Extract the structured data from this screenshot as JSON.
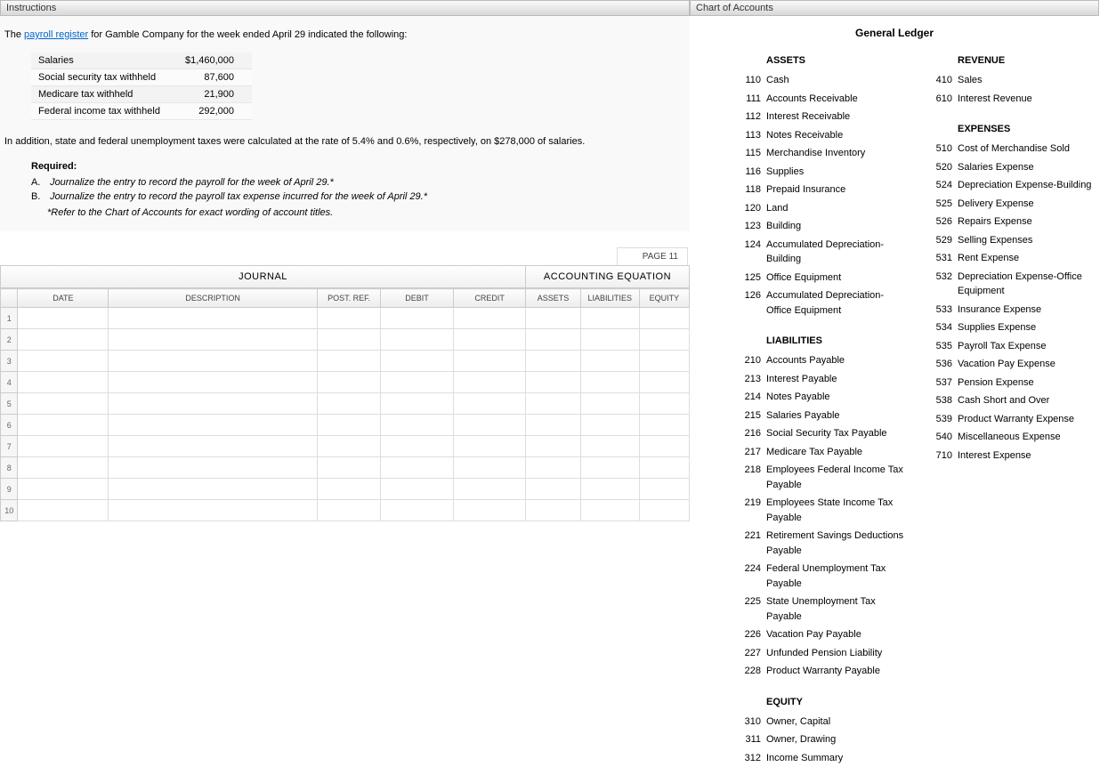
{
  "left": {
    "header": "Instructions",
    "intro_pre": "The ",
    "intro_link": "payroll register",
    "intro_post": " for Gamble Company for the week ended April 29 indicated the following:",
    "rows": [
      {
        "label": "Salaries",
        "value": "$1,460,000"
      },
      {
        "label": "Social security tax withheld",
        "value": "87,600"
      },
      {
        "label": "Medicare tax withheld",
        "value": "21,900"
      },
      {
        "label": "Federal income tax withheld",
        "value": "292,000"
      }
    ],
    "addl": "In addition, state and federal unemployment taxes were calculated at the rate of 5.4% and 0.6%, respectively, on $278,000 of salaries.",
    "required_h": "Required:",
    "req_a_lbl": "A.",
    "req_a": "Journalize the entry to record the payroll for the week of April 29.*",
    "req_b_lbl": "B.",
    "req_b": "Journalize the entry to record the payroll tax expense incurred for the week of April 29.*",
    "note": "*Refer to the Chart of Accounts for exact wording of account titles."
  },
  "journal": {
    "page": "PAGE 11",
    "h_journal": "JOURNAL",
    "h_acct": "ACCOUNTING EQUATION",
    "cols": {
      "date": "DATE",
      "desc": "DESCRIPTION",
      "post": "POST. REF.",
      "debit": "DEBIT",
      "credit": "CREDIT",
      "assets": "ASSETS",
      "liab": "LIABILITIES",
      "eq": "EQUITY"
    },
    "row_count": 10
  },
  "right": {
    "header": "Chart of Accounts",
    "title": "General Ledger",
    "sections": {
      "assets": {
        "h": "ASSETS",
        "items": [
          {
            "n": "110",
            "name": "Cash"
          },
          {
            "n": "111",
            "name": "Accounts Receivable"
          },
          {
            "n": "112",
            "name": "Interest Receivable"
          },
          {
            "n": "113",
            "name": "Notes Receivable"
          },
          {
            "n": "115",
            "name": "Merchandise Inventory"
          },
          {
            "n": "116",
            "name": "Supplies"
          },
          {
            "n": "118",
            "name": "Prepaid Insurance"
          },
          {
            "n": "120",
            "name": "Land"
          },
          {
            "n": "123",
            "name": "Building"
          },
          {
            "n": "124",
            "name": "Accumulated Depreciation-Building"
          },
          {
            "n": "125",
            "name": "Office Equipment"
          },
          {
            "n": "126",
            "name": "Accumulated Depreciation-Office Equipment"
          }
        ]
      },
      "liabilities": {
        "h": "LIABILITIES",
        "items": [
          {
            "n": "210",
            "name": "Accounts Payable"
          },
          {
            "n": "213",
            "name": "Interest Payable"
          },
          {
            "n": "214",
            "name": "Notes Payable"
          },
          {
            "n": "215",
            "name": "Salaries Payable"
          },
          {
            "n": "216",
            "name": "Social Security Tax Payable"
          },
          {
            "n": "217",
            "name": "Medicare Tax Payable"
          },
          {
            "n": "218",
            "name": "Employees Federal Income Tax Payable"
          },
          {
            "n": "219",
            "name": "Employees State Income Tax Payable"
          },
          {
            "n": "221",
            "name": "Retirement Savings Deductions Payable"
          },
          {
            "n": "224",
            "name": "Federal Unemployment Tax Payable"
          },
          {
            "n": "225",
            "name": "State Unemployment Tax Payable"
          },
          {
            "n": "226",
            "name": "Vacation Pay Payable"
          },
          {
            "n": "227",
            "name": "Unfunded Pension Liability"
          },
          {
            "n": "228",
            "name": "Product Warranty Payable"
          }
        ]
      },
      "equity": {
        "h": "EQUITY",
        "items": [
          {
            "n": "310",
            "name": "Owner, Capital"
          },
          {
            "n": "311",
            "name": "Owner, Drawing"
          },
          {
            "n": "312",
            "name": "Income Summary"
          }
        ]
      },
      "revenue": {
        "h": "REVENUE",
        "items": [
          {
            "n": "410",
            "name": "Sales"
          },
          {
            "n": "610",
            "name": "Interest Revenue"
          }
        ]
      },
      "expenses": {
        "h": "EXPENSES",
        "items": [
          {
            "n": "510",
            "name": "Cost of Merchandise Sold"
          },
          {
            "n": "520",
            "name": "Salaries Expense"
          },
          {
            "n": "524",
            "name": "Depreciation Expense-Building"
          },
          {
            "n": "525",
            "name": "Delivery Expense"
          },
          {
            "n": "526",
            "name": "Repairs Expense"
          },
          {
            "n": "529",
            "name": "Selling Expenses"
          },
          {
            "n": "531",
            "name": "Rent Expense"
          },
          {
            "n": "532",
            "name": "Depreciation Expense-Office Equipment"
          },
          {
            "n": "533",
            "name": "Insurance Expense"
          },
          {
            "n": "534",
            "name": "Supplies Expense"
          },
          {
            "n": "535",
            "name": "Payroll Tax Expense"
          },
          {
            "n": "536",
            "name": "Vacation Pay Expense"
          },
          {
            "n": "537",
            "name": "Pension Expense"
          },
          {
            "n": "538",
            "name": "Cash Short and Over"
          },
          {
            "n": "539",
            "name": "Product Warranty Expense"
          },
          {
            "n": "540",
            "name": "Miscellaneous Expense"
          },
          {
            "n": "710",
            "name": "Interest Expense"
          }
        ]
      }
    }
  }
}
